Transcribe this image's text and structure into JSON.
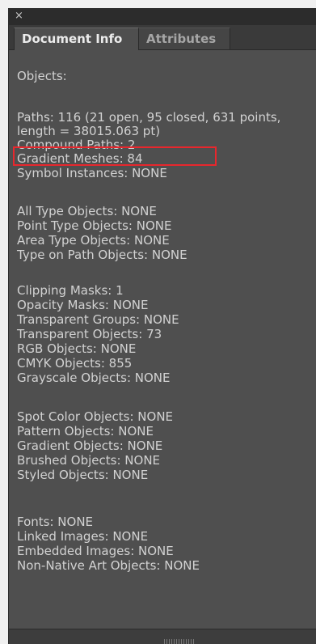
{
  "panel": {
    "close_label": "×",
    "tabs": [
      "Document Info",
      "Attributes"
    ],
    "lines": [
      "Objects:",
      "",
      "Paths: 116 (21 open, 95 closed, 631 points,",
      "length = 38015.063 pt)",
      "Compound Paths: 2",
      "Gradient Meshes: 84",
      "Symbol Instances: NONE",
      "",
      "All Type Objects: NONE",
      "Point Type Objects: NONE",
      "Area Type Objects: NONE",
      "Type on Path Objects: NONE",
      "",
      "Clipping Masks: 1",
      "Opacity Masks: NONE",
      "Transparent Groups: NONE",
      "Transparent Objects: 73",
      "RGB Objects: NONE",
      "CMYK Objects: 855",
      "Grayscale Objects: NONE",
      "",
      "Spot Color Objects: NONE",
      "Pattern Objects: NONE",
      "Gradient Objects: NONE",
      "Brushed Objects: NONE",
      "Styled Objects: NONE",
      "",
      "Fonts: NONE",
      "Linked Images: NONE",
      "Embedded Images: NONE",
      "Non-Native Art Objects: NONE"
    ]
  },
  "colors": {
    "panel_bg": "#4f4f4f",
    "text": "#d2d2d2",
    "highlight": "#e8272d"
  }
}
